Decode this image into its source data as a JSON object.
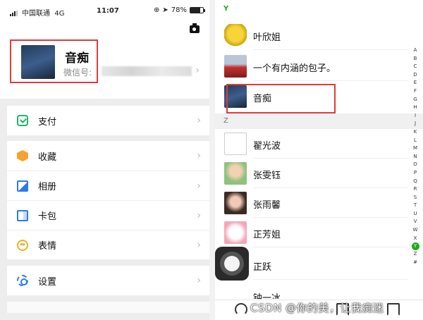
{
  "status_bar": {
    "carrier": "中国联通",
    "network": "4G",
    "time": "11:07",
    "battery": "78%",
    "battery_level": 0.78
  },
  "me": {
    "name": "音痴",
    "wechat_id_label": "微信号:"
  },
  "menu": {
    "group1": [
      {
        "label": "支付",
        "icon": "pay-icon",
        "color": "#20b46a"
      }
    ],
    "group2": [
      {
        "label": "收藏",
        "icon": "favorites-icon",
        "color": "#f3a32e"
      },
      {
        "label": "相册",
        "icon": "album-icon",
        "color": "#2d7ce6"
      },
      {
        "label": "卡包",
        "icon": "cards-icon",
        "color": "#2d7ce6"
      },
      {
        "label": "表情",
        "icon": "emoji-icon",
        "color": "#f0b024"
      }
    ],
    "group3": [
      {
        "label": "设置",
        "icon": "settings-icon",
        "color": "#2d7ce6"
      }
    ]
  },
  "contacts": {
    "section_y": "Y",
    "section_z": "Z",
    "y_list": [
      "叶欣姐",
      "一个有内涵的包子。",
      "音痴"
    ],
    "z_list": [
      "翟光波",
      "张雯钰",
      "张雨馨",
      "正芳姐",
      "正跃",
      "钟一冰"
    ]
  },
  "index_letters": [
    "A",
    "B",
    "C",
    "D",
    "E",
    "F",
    "G",
    "H",
    "I",
    "J",
    "K",
    "L",
    "M",
    "N",
    "O",
    "P",
    "Q",
    "R",
    "S",
    "T",
    "U",
    "V",
    "W",
    "X",
    "Y",
    "Z",
    "#"
  ],
  "index_selected": "Y",
  "watermark": "CSDN @你的美，让我痴迷"
}
